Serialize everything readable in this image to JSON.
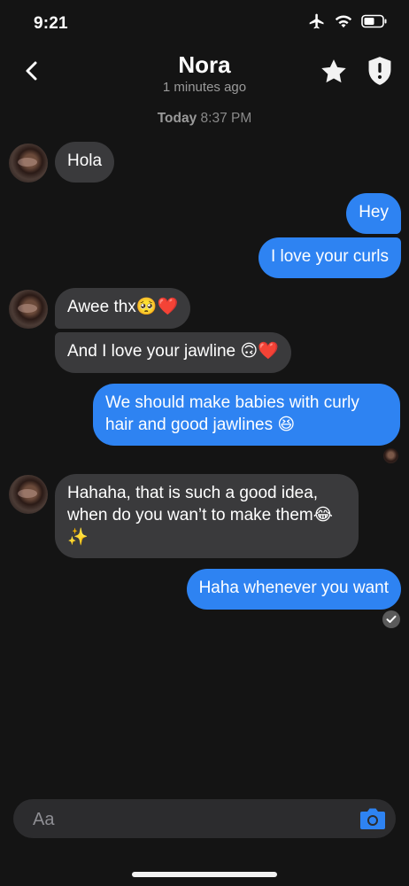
{
  "status_bar": {
    "time": "9:21"
  },
  "header": {
    "contact_name": "Nora",
    "last_active": "1 minutes ago"
  },
  "conversation": {
    "date_label": "Today",
    "time_label": "8:37 PM",
    "messages": [
      {
        "from": "them",
        "text": "Hola"
      },
      {
        "from": "me",
        "text": "Hey"
      },
      {
        "from": "me",
        "text": "I love your curls"
      },
      {
        "from": "them",
        "text": "Awee thx🥺❤️"
      },
      {
        "from": "them",
        "text": "And I love your jawline 🙃❤️"
      },
      {
        "from": "me",
        "text": "We should make babies with curly hair and good jawlines 😆"
      },
      {
        "from": "them",
        "text": "Hahaha, that is such a good idea, when do you wan’t to make them😂✨"
      },
      {
        "from": "me",
        "text": "Haha whenever you want"
      }
    ]
  },
  "composer": {
    "placeholder": "Aa"
  },
  "colors": {
    "background": "#141414",
    "outgoing_bubble": "#2e83f2",
    "incoming_bubble": "#3a3a3c",
    "camera_icon": "#2e83f2"
  },
  "icons": {
    "back": "chevron-left-icon",
    "favorite": "star-icon",
    "safety": "shield-alert-icon",
    "camera": "camera-icon",
    "status": [
      "airplane-icon",
      "wifi-icon",
      "battery-icon"
    ]
  }
}
